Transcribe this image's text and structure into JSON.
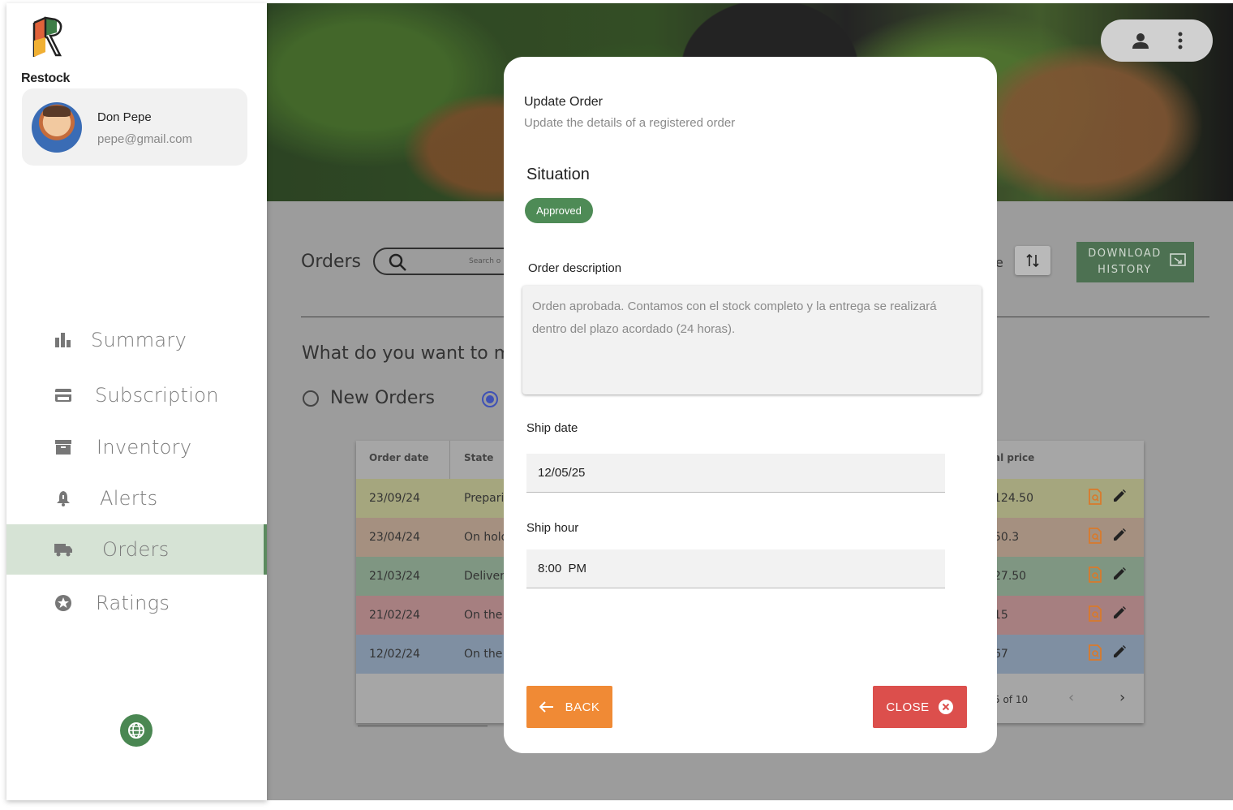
{
  "brand": {
    "name": "Restock"
  },
  "profile": {
    "name": "Don Pepe",
    "email": "pepe@gmail.com"
  },
  "nav": [
    {
      "label": "Summary",
      "icon": "bar-chart-icon",
      "active": false
    },
    {
      "label": "Subscription",
      "icon": "credit-card-icon",
      "active": false
    },
    {
      "label": "Inventory",
      "icon": "archive-icon",
      "active": false
    },
    {
      "label": "Alerts",
      "icon": "bell-icon",
      "active": false
    },
    {
      "label": "Orders",
      "icon": "truck-icon",
      "active": true
    },
    {
      "label": "Ratings",
      "icon": "star-icon",
      "active": false
    }
  ],
  "page": {
    "title": "Orders",
    "search_placeholder": "Search o",
    "sort_fragment": "e",
    "download_label_1": "DOWNLOAD",
    "download_label_2": "HISTORY",
    "question": "What do you want to m",
    "radio_new_orders": "New Orders"
  },
  "table": {
    "headers": {
      "order_date": "Order date",
      "state": "State",
      "total_price": "al price"
    },
    "rows": [
      {
        "date": "23/09/24",
        "state": "Preparin",
        "price": "124.50",
        "color": "#a5a67e"
      },
      {
        "date": "23/04/24",
        "state": "On hold",
        "price": "50.3",
        "color": "#a59080"
      },
      {
        "date": "21/03/24",
        "state": "Delivere",
        "price": "27.50",
        "color": "#7f9682"
      },
      {
        "date": "21/02/24",
        "state": "On the v",
        "price": "15",
        "color": "#a67f80"
      },
      {
        "date": "12/02/24",
        "state": "On the v",
        "price": "67",
        "color": "#7f8fa2"
      }
    ],
    "pagination": "5 of 10"
  },
  "modal": {
    "title": "Update Order",
    "subtitle": "Update the details of a registered order",
    "situation_label": "Situation",
    "situation_badge": "Approved",
    "description_label": "Order description",
    "description_value": "Orden aprobada. Contamos con el stock completo y la entrega se realizará dentro del plazo acordado (24 horas).",
    "ship_date_label": "Ship date",
    "ship_date_value": "12/05/25",
    "ship_hour_label": "Ship hour",
    "ship_hour_value": "8:00  PM",
    "back_label": "BACK",
    "close_label": "CLOSE"
  },
  "colors": {
    "accent_green": "#4e8b56",
    "back_orange": "#f08a35",
    "close_red": "#dc4f4c",
    "nav_active_bg": "#d6e3d5"
  }
}
